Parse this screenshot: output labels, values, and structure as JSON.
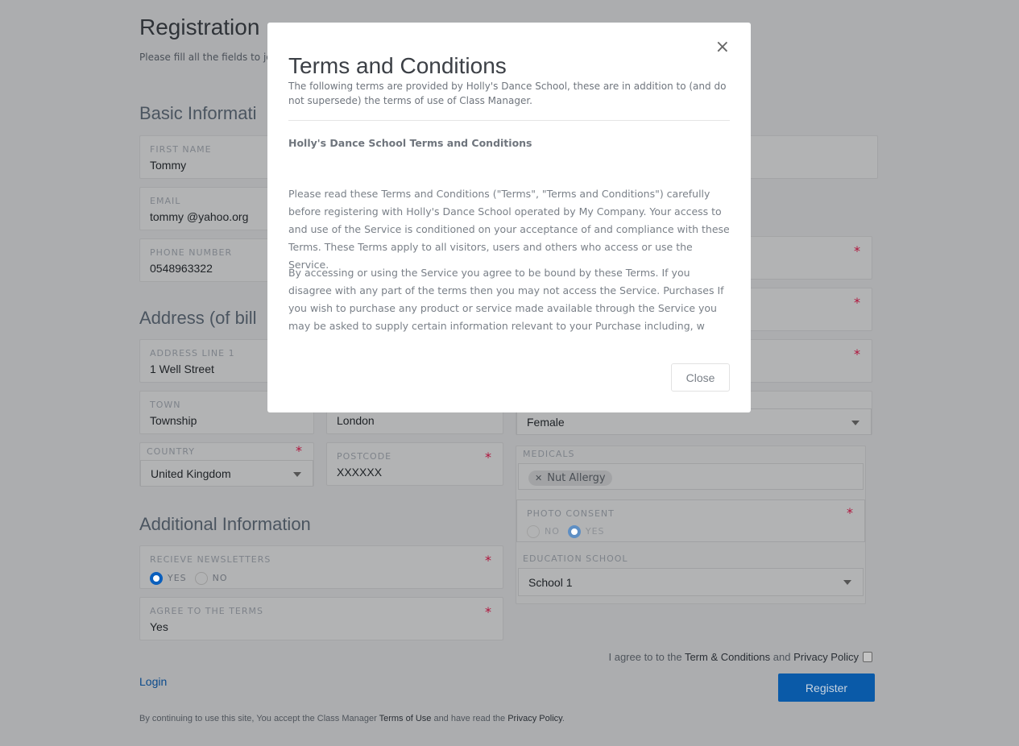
{
  "page": {
    "title": "Registration",
    "subtitle": "Please fill all the fields to joi"
  },
  "sections": {
    "basic": "Basic Informati",
    "address": "Address (of bill",
    "additional": "Additional Information"
  },
  "fields": {
    "first_name": {
      "label": "FIRST NAME",
      "value": "Tommy"
    },
    "email": {
      "label": "EMAIL",
      "value": "tommy @yahoo.org"
    },
    "phone": {
      "label": "PHONE NUMBER",
      "value": "0548963322"
    },
    "address1": {
      "label": "ADDRESS LINE 1",
      "value": "1 Well Street"
    },
    "town": {
      "label": "TOWN",
      "value": "Township"
    },
    "county": {
      "value": "London"
    },
    "country": {
      "label": "COUNTRY",
      "value": "United Kingdom"
    },
    "postcode": {
      "label": "POSTCODE",
      "value": "XXXXXX"
    },
    "gender": {
      "value": "Female"
    },
    "medicals": {
      "label": "MEDICALS",
      "tag": "Nut Allergy"
    },
    "photo_consent": {
      "label": "PHOTO CONSENT",
      "no": "NO",
      "yes": "YES",
      "selected": "YES"
    },
    "education": {
      "label": "EDUCATION SCHOOL",
      "value": "School 1"
    },
    "newsletters": {
      "label": "RECIEVE NEWSLETTERS",
      "yes": "YES",
      "no": "NO",
      "selected": "YES"
    },
    "agree_terms": {
      "label": "AGREE TO THE TERMS",
      "value": "Yes"
    }
  },
  "required_mark": "*",
  "agree": {
    "pre": "I agree to to the ",
    "terms": "Term & Conditions",
    "mid": " and ",
    "privacy": "Privacy Policy",
    "checked": false
  },
  "login": "Login",
  "register": "Register",
  "footer": {
    "pre": "By continuing to use this site, You accept the Class Manager ",
    "terms": "Terms of Use",
    "mid": " and have read the ",
    "privacy": "Privacy Policy",
    "end": "."
  },
  "modal": {
    "title": "Terms and Conditions",
    "subtitle": "The following terms are provided by Holly's Dance School, these are in addition to (and do not supersede) the terms of use of Class Manager.",
    "heading": "Holly's Dance School Terms and Conditions",
    "p1": "Please read these Terms and Conditions (\"Terms\", \"Terms and Conditions\") carefully before registering with Holly's Dance School operated by My Company. Your access to and use of the Service is conditioned on your acceptance of and compliance with these Terms. These Terms apply to all visitors, users and others who access or use the Service.",
    "p2": "By accessing or using the Service you agree to be bound by these Terms. If you disagree with any part of the terms then you may not access the Service. Purchases If you wish to purchase any product or service made available through the Service you may be asked to supply certain information relevant to your Purchase including, w",
    "close_x": "×",
    "close": "Close"
  },
  "colors": {
    "overlay": "#acadaf",
    "primary": "#0a5fbd",
    "required": "#b0143c"
  }
}
